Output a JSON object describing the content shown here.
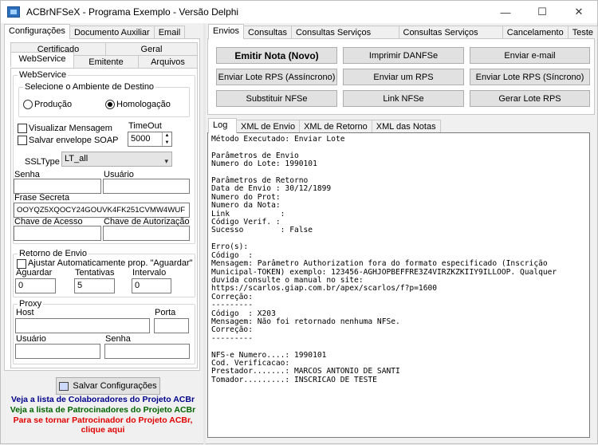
{
  "window": {
    "title": "ACBrNFSeX - Programa Exemplo - Versão Delphi",
    "minimize": "—",
    "maximize": "☐",
    "close": "✕"
  },
  "left": {
    "tabs": [
      "Configurações",
      "Documento Auxiliar",
      "Email"
    ],
    "subtabs_row1": [
      "Certificado",
      "Geral"
    ],
    "subtabs_row2": [
      "WebService",
      "Emitente",
      "Arquivos"
    ],
    "webservice": {
      "group_title": "WebService",
      "ambiente_title": "Selecione o Ambiente de Destino",
      "producao": "Produção",
      "homologacao": "Homologação",
      "visualizar": "Visualizar Mensagem",
      "salvar_envelope": "Salvar envelope SOAP",
      "timeout_label": "TimeOut",
      "timeout_value": "5000",
      "ssltype_label": "SSLType",
      "ssltype_value": "LT_all",
      "senha_label": "Senha",
      "usuario_label": "Usuário",
      "frase_label": "Frase Secreta",
      "frase_value": "OOYQZ5XQOCY24GOUVK4FK251CVMW4WUF",
      "chave_acesso_label": "Chave de Acesso",
      "chave_autorizacao_label": "Chave de Autorização"
    },
    "retorno": {
      "title": "Retorno de Envio",
      "ajustar": "Ajustar Automaticamente prop. \"Aguardar\"",
      "aguardar_label": "Aguardar",
      "aguardar_value": "0",
      "tentativas_label": "Tentativas",
      "tentativas_value": "5",
      "intervalo_label": "Intervalo",
      "intervalo_value": "0"
    },
    "proxy": {
      "title": "Proxy",
      "host_label": "Host",
      "porta_label": "Porta",
      "usuario_label": "Usuário",
      "senha_label": "Senha"
    },
    "salvar_button": "Salvar Configurações",
    "links": {
      "colaboradores": "Veja a lista de Colaboradores do Projeto ACBr",
      "patrocinadores": "Veja a lista de Patrocinadores do Projeto ACBr",
      "tornar_1": "Para se tornar Patrocinador do Projeto ACBr,",
      "tornar_2": "clique aqui"
    }
  },
  "right": {
    "tabs": [
      "Envios",
      "Consultas",
      "Consultas Serviços Prestados",
      "Consultas Serviços Tomados",
      "Cancelamento",
      "Teste"
    ],
    "buttons": {
      "emitir": "Emitir Nota (Novo)",
      "imprimir": "Imprimir DANFSe",
      "email": "Enviar e-mail",
      "lote_assinc": "Enviar Lote RPS (Assíncrono)",
      "um_rps": "Enviar um RPS",
      "lote_sinc": "Enviar Lote RPS (Síncrono)",
      "substituir": "Substituir NFSe",
      "link": "Link NFSe",
      "gerar": "Gerar Lote RPS"
    },
    "log_tabs": [
      "Log",
      "XML de Envio",
      "XML de Retorno",
      "XML das Notas"
    ],
    "log_lines": [
      "Método Executado: Enviar Lote",
      "",
      "Parâmetros de Envio",
      "Numero do Lote: 1990101",
      "",
      "Parâmetros de Retorno",
      "Data de Envio : 30/12/1899",
      "Numero do Prot:",
      "Numero da Nota:",
      "Link           :",
      "Código Verif. :",
      "Sucesso        : False",
      "",
      "Erro(s):",
      "Código  :",
      "Mensagem: Parâmetro Authorization fora do formato especificado (Inscrição",
      "Municipal-TOKEN) exemplo: 123456-AGHJOPBEFFRE3Z4VIRZKZKIIY9ILLOOP. Qualquer",
      "duvida consulte o manual no site:",
      "https://scarlos.giap.com.br/apex/scarlos/f?p=1600",
      "Correção:",
      "---------",
      "Código  : X203",
      "Mensagem: Não foi retornado nenhuma NFSe.",
      "Correção:",
      "---------",
      "",
      "NFS-e Numero....: 1990101",
      "Cod. Verificacao:",
      "Prestador.......: MARCOS ANTONIO DE SANTI",
      "Tomador.........: INSCRICAO DE TESTE"
    ]
  }
}
